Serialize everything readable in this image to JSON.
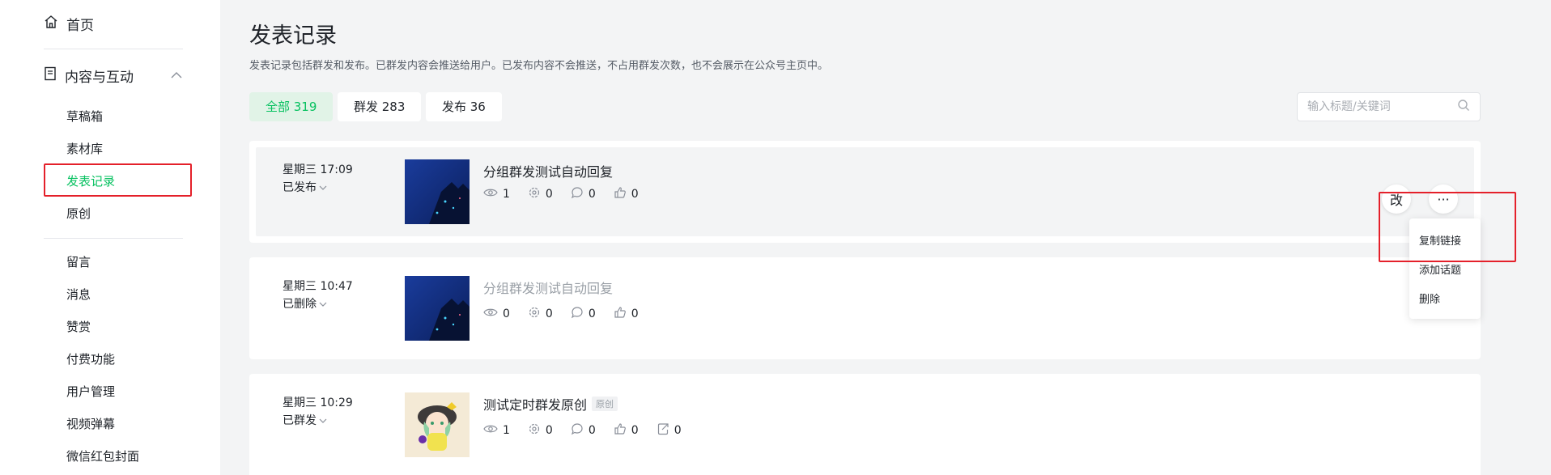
{
  "sidebar": {
    "home_label": "首页",
    "section_label": "内容与互动",
    "items": [
      {
        "label": "草稿箱"
      },
      {
        "label": "素材库"
      },
      {
        "label": "发表记录"
      },
      {
        "label": "原创"
      },
      {
        "label": "留言"
      },
      {
        "label": "消息"
      },
      {
        "label": "赞赏"
      },
      {
        "label": "付费功能"
      },
      {
        "label": "用户管理"
      },
      {
        "label": "视频弹幕"
      },
      {
        "label": "微信红包封面"
      }
    ]
  },
  "main": {
    "title": "发表记录",
    "description": "发表记录包括群发和发布。已群发内容会推送给用户。已发布内容不会推送，不占用群发次数，也不会展示在公众号主页中。",
    "tabs": [
      {
        "label": "全部 319"
      },
      {
        "label": "群发 283"
      },
      {
        "label": "发布 36"
      }
    ],
    "search": {
      "placeholder": "输入标题/关键词"
    }
  },
  "records": [
    {
      "datetime": "星期三 17:09",
      "status": "已发布",
      "title": "分组群发测试自动回复",
      "stats": {
        "views": "1",
        "shares": "0",
        "comments": "0",
        "likes": "0"
      }
    },
    {
      "datetime": "星期三 10:47",
      "status": "已删除",
      "title": "分组群发测试自动回复",
      "stats": {
        "views": "0",
        "shares": "0",
        "comments": "0",
        "likes": "0"
      }
    },
    {
      "datetime": "星期三 10:29",
      "status": "已群发",
      "title": "测试定时群发原创",
      "badge": "原创",
      "stats": {
        "views": "1",
        "shares": "0",
        "comments": "0",
        "likes": "0",
        "forwards": "0"
      }
    }
  ],
  "actions": {
    "edit_label": "改",
    "more_label": "···",
    "menu": [
      {
        "label": "复制链接"
      },
      {
        "label": "添加话题"
      },
      {
        "label": "删除"
      }
    ]
  },
  "colors": {
    "accent": "#07c160",
    "highlight_box": "#e4202a"
  },
  "icons": [
    "home-icon",
    "document-icon",
    "chevron-up-icon",
    "chevron-down-icon",
    "search-icon",
    "eye-icon",
    "share-icon",
    "comment-icon",
    "thumbs-up-icon",
    "forward-icon"
  ]
}
